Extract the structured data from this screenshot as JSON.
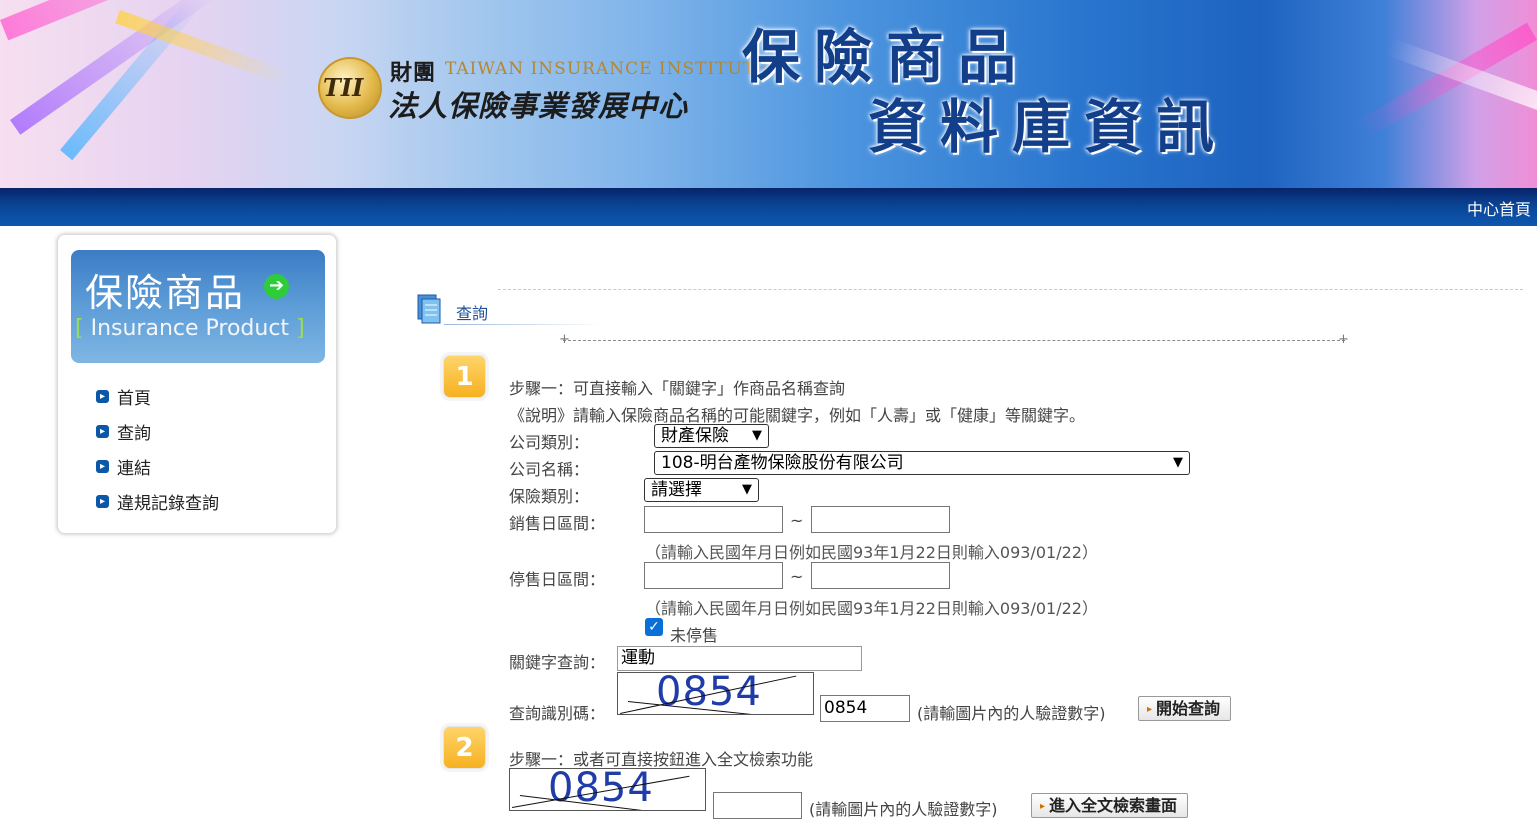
{
  "banner": {
    "org_logo_text": "TII",
    "org_name_cn_top": "財團",
    "org_name_en": "TAIWAN INSURANCE INSTITUTE",
    "org_name_cn_bottom": "法人保險事業發展中心",
    "title_line1": "保險商品",
    "title_line2": "資料庫資訊"
  },
  "nav": {
    "home_link": "中心首頁"
  },
  "sidebar": {
    "product_cn": "保險商品",
    "product_en": "Insurance Product",
    "product_en_open": "[",
    "product_en_close": "]",
    "menu": [
      {
        "label": "首頁"
      },
      {
        "label": "查詢"
      },
      {
        "label": "連結"
      },
      {
        "label": "違規記錄查詢"
      }
    ]
  },
  "main": {
    "section_title": "查詢",
    "step1": {
      "badge": "1",
      "heading": "步驟一：可直接輸入「關鍵字」作商品名稱查詢",
      "description": "《說明》請輸入保險商品名稱的可能關鍵字，例如「人壽」或「健康」等關鍵字。",
      "company_type_label": "公司類別：",
      "company_type_value": "財產保險",
      "company_name_label": "公司名稱：",
      "company_name_value": "108-明台產物保險股份有限公司",
      "insurance_type_label": "保險類別：",
      "insurance_type_value": "請選擇",
      "sale_range_label": "銷售日區間：",
      "range_sep": "~",
      "date_hint": "（請輸入民國年月日例如民國93年1月22日則輸入093/01/22）",
      "stop_range_label": "停售日區間：",
      "not_stopped_label": "未停售",
      "not_stopped_checked": true,
      "keyword_label": "關鍵字查詢：",
      "keyword_value": "運動",
      "captcha_label": "查詢識別碼：",
      "captcha_image_text": "0854",
      "captcha_input_value": "0854",
      "captcha_hint": "(請輸圖片內的人驗證數字)",
      "search_button": "開始查詢"
    },
    "step2": {
      "badge": "2",
      "heading": "步驟一：或者可直接按鈕進入全文檢索功能",
      "captcha_image_text": "0854",
      "captcha_input_value": "",
      "captcha_hint": "(請輸圖片內的人驗證數字)",
      "fulltext_button": "進入全文檢索畫面"
    }
  },
  "colors": {
    "nav_bar": "#0b4a9e",
    "title_blue": "#123e8a",
    "step_badge": "#f6b120",
    "link_blue": "#1c4f97"
  }
}
